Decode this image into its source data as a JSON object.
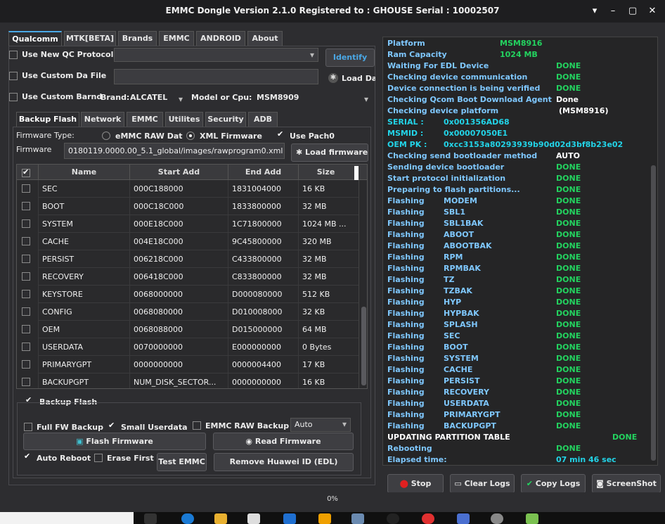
{
  "window": {
    "title": "EMMC Dongle Version 2.1.0 Registered to : GHOUSE    Serial : 10002507"
  },
  "main_tabs": [
    {
      "label": "Qualcomm",
      "active": true
    },
    {
      "label": "MTK[BETA]",
      "active": false
    },
    {
      "label": "Brands",
      "active": false
    },
    {
      "label": "EMMC",
      "active": false
    },
    {
      "label": "ANDROID",
      "active": false
    },
    {
      "label": "About",
      "active": false
    }
  ],
  "options": {
    "use_new_qc": "Use New QC Protocol",
    "use_custom_da": "Use Custom Da File",
    "use_custom_brand": "Use Custom Barnd",
    "brand_label": "Brand:",
    "brand_value": "ALCATEL",
    "model_label": "Model or Cpu:",
    "model_value": "MSM8909",
    "identify": "Identify",
    "load_da": "Load Da"
  },
  "sub_tabs": [
    {
      "label": "Backup  Flash",
      "active": true
    },
    {
      "label": "Network",
      "active": false
    },
    {
      "label": "EMMC",
      "active": false
    },
    {
      "label": "Utilites",
      "active": false
    },
    {
      "label": "Security",
      "active": false
    },
    {
      "label": "ADB",
      "active": false
    }
  ],
  "firmware": {
    "type_label": "Firmware Type:",
    "emmc_raw": "eMMC RAW Dat",
    "xml_firmware": "XML Firmware",
    "use_pach": "Use Pach0",
    "firmware_label": "Firmware",
    "firmware_path": "0180119.0000.00_5.1_global/images/rawprogram0.xml",
    "load_firmware": "Load firmware fi"
  },
  "table": {
    "columns": [
      "Name",
      "Start Add",
      "End Add",
      "Size"
    ],
    "rows": [
      {
        "name": "SEC",
        "start": "000C188000",
        "end": "1831004000",
        "size": "16 KB"
      },
      {
        "name": "BOOT",
        "start": "000C18C000",
        "end": "1833800000",
        "size": "32 MB"
      },
      {
        "name": "SYSTEM",
        "start": "000E18C000",
        "end": "1C71800000",
        "size": "1024 MB   ..."
      },
      {
        "name": "CACHE",
        "start": "004E18C000",
        "end": "9C45800000",
        "size": "320 MB"
      },
      {
        "name": "PERSIST",
        "start": "006218C000",
        "end": "C433800000",
        "size": "32 MB"
      },
      {
        "name": "RECOVERY",
        "start": "006418C000",
        "end": "C833800000",
        "size": "32 MB"
      },
      {
        "name": "KEYSTORE",
        "start": "0068000000",
        "end": "D000080000",
        "size": "512 KB"
      },
      {
        "name": "CONFIG",
        "start": "0068080000",
        "end": "D010008000",
        "size": "32 KB"
      },
      {
        "name": "OEM",
        "start": "0068088000",
        "end": "D015000000",
        "size": "64 MB"
      },
      {
        "name": "USERDATA",
        "start": "0070000000",
        "end": "E000000000",
        "size": "0 Bytes"
      },
      {
        "name": "PRIMARYGPT",
        "start": "0000000000",
        "end": "0000004400",
        "size": "17 KB"
      },
      {
        "name": "BACKUPGPT",
        "start": "NUM_DISK_SECTOR...",
        "end": "0000000000",
        "size": "16 KB"
      }
    ]
  },
  "backup": {
    "group_label": "Backup  Flash",
    "full_fw": "Full FW Backup",
    "small_userdata": "Small Userdata",
    "emmc_raw_backup": "EMMC RAW Backup",
    "mode_value": "Auto",
    "flash_firmware": "Flash Firmware",
    "read_firmware": "Read Firmware",
    "auto_reboot": "Auto Reboot",
    "erase_first": "Erase First",
    "test_emmc": "Test EMMC",
    "remove_huawei": "Remove Huawei ID (EDL)"
  },
  "log": {
    "header": [
      {
        "label": "Platform",
        "value": "MSM8916"
      },
      {
        "label": "Ram Capacity",
        "value": "1024 MB"
      }
    ],
    "steps": [
      {
        "label": "Waiting For EDL Device",
        "value": "DONE",
        "kind": "ok"
      },
      {
        "label": "Checking device communication",
        "value": "DONE",
        "kind": "ok"
      },
      {
        "label": "Device connection is being verified",
        "value": "DONE",
        "kind": "ok"
      },
      {
        "label": "Checking Qcom Boot Download Agent",
        "value": "Done",
        "kind": "w"
      },
      {
        "label": "Checking device platform",
        "value": "(MSM8916)",
        "kind": "w"
      }
    ],
    "ids": [
      {
        "label": "SERIAL :",
        "value": "0x001356AD68"
      },
      {
        "label": "MSMID  :",
        "value": "0x00007050E1"
      },
      {
        "label": "OEM PK :",
        "value": "0xcc3153a80293939b90d02d3bf8b23e02"
      }
    ],
    "steps2": [
      {
        "label": "Checking send bootloader method",
        "value": "AUTO",
        "kind": "w"
      },
      {
        "label": "Sending device bootloader",
        "value": "DONE",
        "kind": "ok"
      },
      {
        "label": "Start protocol initialization",
        "value": "DONE",
        "kind": "ok"
      },
      {
        "label": "Preparing to flash partitions...",
        "value": "DONE",
        "kind": "ok"
      }
    ],
    "flashing_label": "Flashing",
    "flashing": [
      {
        "part": "MODEM",
        "value": "DONE"
      },
      {
        "part": "SBL1",
        "value": "DONE"
      },
      {
        "part": "SBL1BAK",
        "value": "DONE"
      },
      {
        "part": "ABOOT",
        "value": "DONE"
      },
      {
        "part": "ABOOTBAK",
        "value": "DONE"
      },
      {
        "part": "RPM",
        "value": "DONE"
      },
      {
        "part": "RPMBAK",
        "value": "DONE"
      },
      {
        "part": "TZ",
        "value": "DONE"
      },
      {
        "part": "TZBAK",
        "value": "DONE"
      },
      {
        "part": "HYP",
        "value": "DONE"
      },
      {
        "part": "HYPBAK",
        "value": "DONE"
      },
      {
        "part": "SPLASH",
        "value": "DONE"
      },
      {
        "part": "SEC",
        "value": "DONE"
      },
      {
        "part": "BOOT",
        "value": "DONE"
      },
      {
        "part": "SYSTEM",
        "value": "DONE"
      },
      {
        "part": "CACHE",
        "value": "DONE"
      },
      {
        "part": "PERSIST",
        "value": "DONE"
      },
      {
        "part": "RECOVERY",
        "value": "DONE"
      },
      {
        "part": "USERDATA",
        "value": "DONE"
      },
      {
        "part": "PRIMARYGPT",
        "value": "DONE"
      },
      {
        "part": "BACKUPGPT",
        "value": "DONE"
      }
    ],
    "updating": {
      "label": "UPDATING PARTITION TABLE",
      "value": "DONE"
    },
    "rebooting": {
      "label": "Rebooting",
      "value": "DONE"
    },
    "elapsed": {
      "label": "Elapsed time:",
      "value": "07 min  46 sec"
    }
  },
  "bottom_buttons": {
    "stop": "Stop",
    "clear_logs": "Clear Logs",
    "copy_logs": "Copy Logs",
    "screenshot": "ScreenShot"
  },
  "progress": {
    "text": "0%",
    "value": 0
  },
  "colors": {
    "accent": "#4aa8e6",
    "ok": "#23d35f",
    "label": "#7fc8ff",
    "cyan": "#22d4e8",
    "stop_icon": "#e02020"
  }
}
